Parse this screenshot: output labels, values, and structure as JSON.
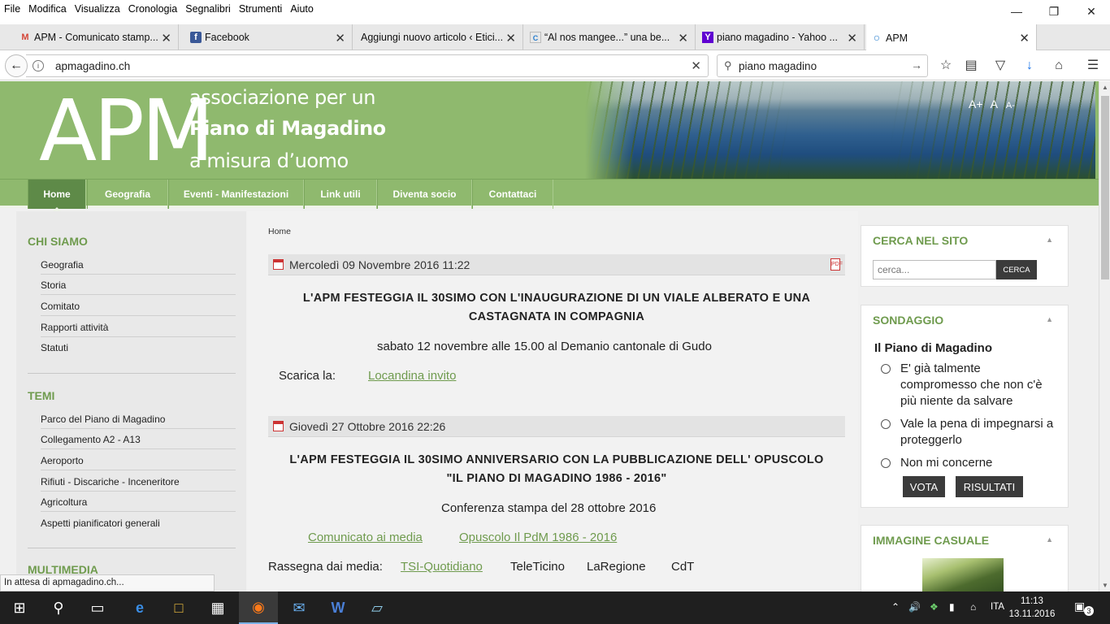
{
  "menubar": [
    "File",
    "Modifica",
    "Visualizza",
    "Cronologia",
    "Segnalibri",
    "Strumenti",
    "Aiuto"
  ],
  "tabs": [
    {
      "label": "APM - Comunicato stamp...",
      "icon": "gmail-icon",
      "glyph": "M"
    },
    {
      "label": "Facebook",
      "icon": "facebook-icon",
      "glyph": "f"
    },
    {
      "label": "Aggiungi nuovo articolo ‹ Etici...",
      "icon": "wordpress-icon",
      "glyph": ""
    },
    {
      "label": "“Al nos mangee...” una be...",
      "icon": "site-icon",
      "glyph": "C"
    },
    {
      "label": "piano magadino - Yahoo ...",
      "icon": "yahoo-icon",
      "glyph": "Y"
    },
    {
      "label": "APM",
      "icon": "loading-icon",
      "glyph": "○"
    }
  ],
  "nav": {
    "url": "apmagadino.ch",
    "search": "piano magadino"
  },
  "header": {
    "logo": "APM",
    "line1": "associazione per un",
    "line2": "Piano di Magadino",
    "line3": "a misura d’uomo",
    "fontsize": [
      "A+",
      "A",
      "A-"
    ]
  },
  "mainnav": [
    "Home",
    "Geografia",
    "Eventi - Manifestazioni",
    "Link utili",
    "Diventa socio",
    "Contattaci"
  ],
  "sidebar": {
    "chi_siamo": {
      "title": "CHI SIAMO",
      "items": [
        "Geografia",
        "Storia",
        "Comitato",
        "Rapporti attività",
        "Statuti"
      ]
    },
    "temi": {
      "title": "TEMI",
      "items": [
        "Parco del Piano di Magadino",
        "Collegamento A2 - A13",
        "Aeroporto",
        "Rifiuti - Discariche - Inceneritore",
        "Agricoltura",
        "Aspetti pianificatori generali"
      ]
    },
    "multimedia": {
      "title": "MULTIMEDIA"
    }
  },
  "breadcrumb": "Home",
  "articles": [
    {
      "date": "Mercoledì 09 Novembre 2016 11:22",
      "title_line1": "L'APM FESTEGGIA IL 30SIMO CON L'INAUGURAZIONE DI UN VIALE ALBERATO E UNA",
      "title_line2": "CASTAGNATA IN COMPAGNIA",
      "subtitle": "sabato 12 novembre alle 15.00 al Demanio cantonale di Gudo",
      "download_label": "Scarica la:",
      "download_link": "Locandina invito"
    },
    {
      "date": "Giovedì 27 Ottobre 2016 22:26",
      "title_line1": "L'APM FESTEGGIA IL 30SIMO ANNIVERSARIO CON LA PUBBLICAZIONE DELL' OPUSCOLO",
      "title_line2": "\"IL PIANO DI MAGADINO 1986 - 2016\"",
      "subtitle": "Conferenza stampa del 28 ottobre 2016",
      "link1": "Comunicato ai media",
      "link2": "Opuscolo Il PdM 1986 - 2016",
      "rassegna_label": "Rassegna dai media:",
      "media": [
        "TSI-Quotidiano",
        "TeleTicino",
        "LaRegione",
        "CdT"
      ]
    }
  ],
  "right": {
    "search": {
      "title": "CERCA NEL SITO",
      "placeholder": "cerca...",
      "button": "CERCA"
    },
    "poll": {
      "title": "SONDAGGIO",
      "question": "Il Piano di Magadino",
      "options": [
        "E' già talmente compromesso che non c'è più niente da salvare",
        "Vale la pena di impegnarsi a proteggerlo",
        "Non mi concerne"
      ],
      "vote": "VOTA",
      "results": "RISULTATI"
    },
    "random_image": {
      "title": "IMMAGINE CASUALE"
    }
  },
  "status": "In attesa di apmagadino.ch...",
  "taskbar": {
    "lang": "ITA",
    "time": "11:13",
    "date": "13.11.2016",
    "notifications": "3"
  },
  "colors": {
    "accent_green": "#8fb96e",
    "heading_green": "#6f9b4e",
    "dark_button": "#3b3b3b"
  }
}
